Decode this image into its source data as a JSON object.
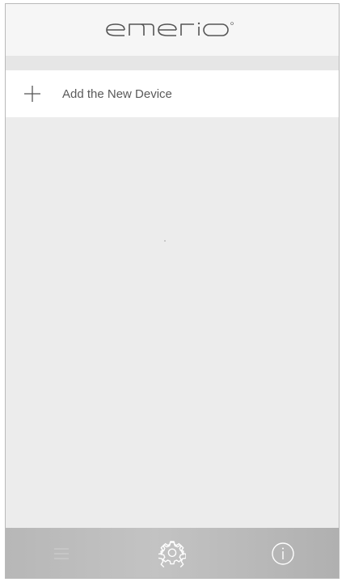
{
  "header": {
    "logo_text": "emerio",
    "logo_icon": "emerio-logo"
  },
  "devices": {
    "add_label": "Add the New Device",
    "add_icon": "plus-icon"
  },
  "tabbar": {
    "items": [
      {
        "icon": "menu-icon"
      },
      {
        "icon": "gear-icon"
      },
      {
        "icon": "info-icon"
      }
    ]
  },
  "colors": {
    "background": "#ebebeb",
    "header": "#f6f6f6",
    "row": "#ffffff",
    "tabbar": "#bdbdbd",
    "text": "#5a5a5a"
  }
}
